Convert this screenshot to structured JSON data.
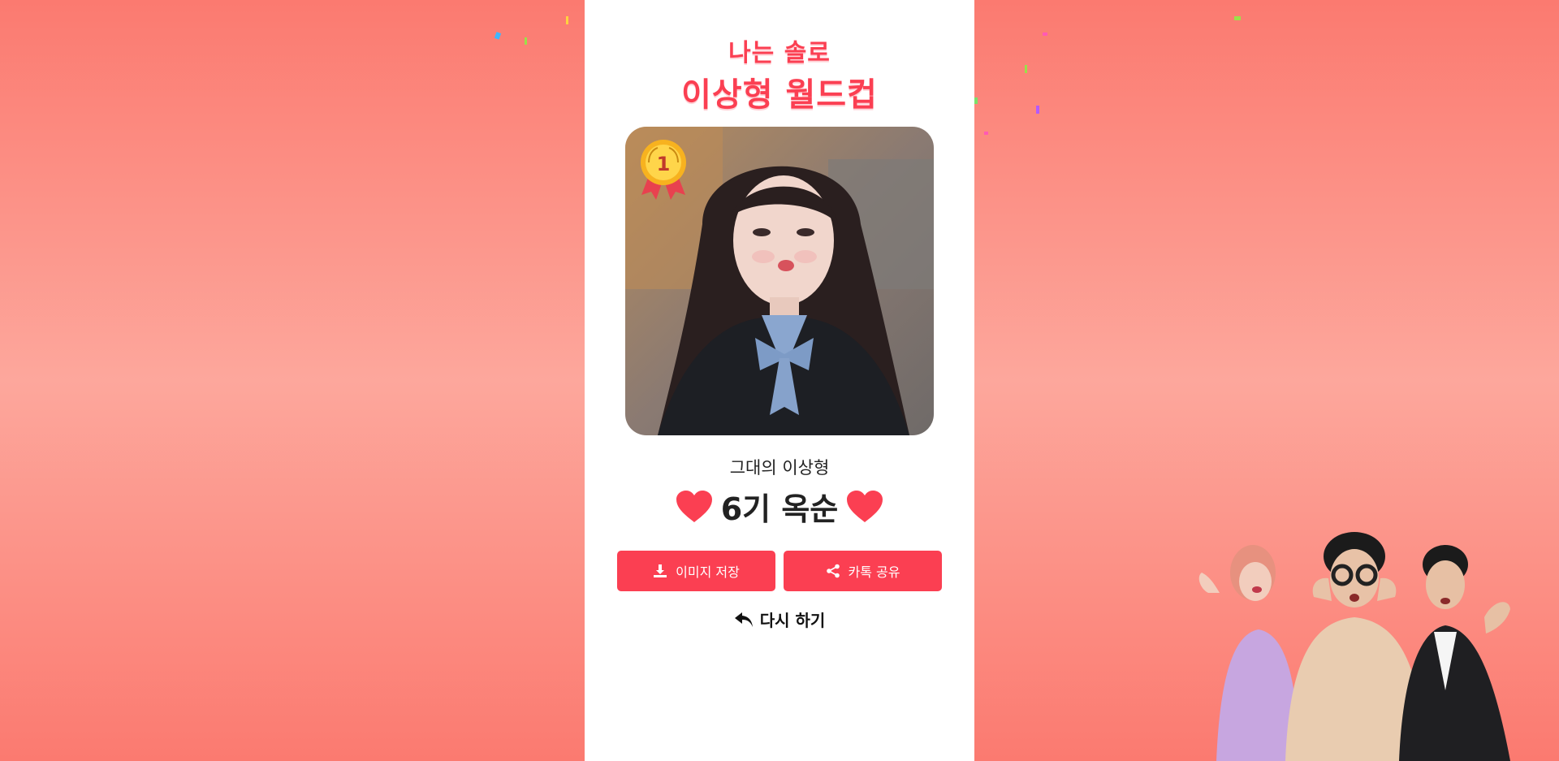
{
  "app": {
    "logo_line1": "나는 솔로",
    "logo_line2": "이상형 월드컵"
  },
  "result": {
    "subtitle": "그대의 이상형",
    "winner": "6기 옥순",
    "rank_badge": "1"
  },
  "actions": {
    "save_label": "이미지 저장",
    "share_label": "카톡 공유",
    "retry_label": "다시 하기"
  },
  "icons": {
    "save": "download-icon",
    "share": "share-icon",
    "retry": "reply-arrow-icon",
    "heart": "heart-icon",
    "medal": "gold-medal-icon"
  },
  "colors": {
    "accent": "#fb3f52",
    "background": "#fb7a70",
    "panel": "#ffffff"
  }
}
